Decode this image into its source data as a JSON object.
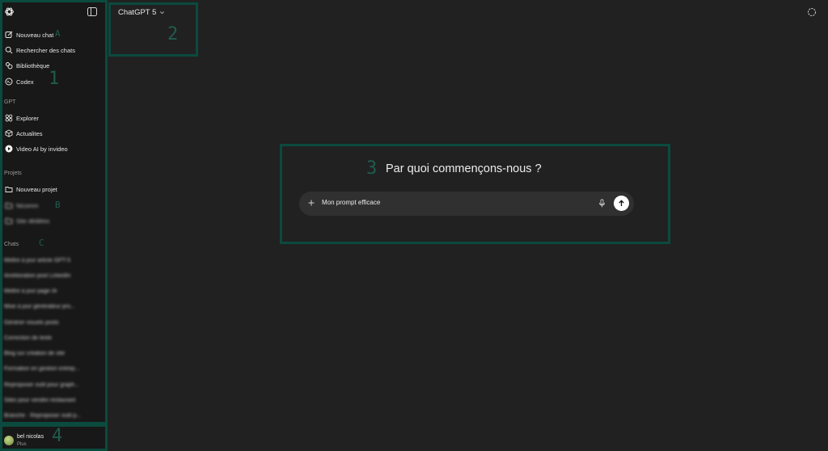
{
  "header": {
    "model_label": "ChatGPT 5"
  },
  "sidebar": {
    "main_items": [
      {
        "label": "Nouveau chat",
        "icon": "edit-icon"
      },
      {
        "label": "Rechercher des chats",
        "icon": "search-icon"
      },
      {
        "label": "Bibliothèque",
        "icon": "library-icon"
      },
      {
        "label": "Codex",
        "icon": "codex-icon"
      }
    ],
    "gpt_section": "GPT",
    "gpt_items": [
      {
        "label": "Explorer",
        "icon": "grid-icon"
      },
      {
        "label": "Actualites",
        "icon": "cube-icon"
      },
      {
        "label": "Video AI by invideo",
        "icon": "invideo-icon"
      }
    ],
    "projects_section": "Projets",
    "project_items": [
      {
        "label": "Nouveau projet",
        "icon": "folder-plus-icon"
      },
      {
        "label": "Nicomm",
        "icon": "folder-icon"
      },
      {
        "label": "Site dédiées",
        "icon": "folder-icon"
      }
    ],
    "chats_section": "Chats",
    "chats": [
      "Mettre à jour article GPT-5",
      "Amélioration post LinkedIn",
      "Mettre à jour page IA",
      "Mise à jour générateur pro...",
      "Générer visuels posts",
      "Correction de texte",
      "Blog sur création de site",
      "Formation en gestion entrep...",
      "Reproposer outil pour graph...",
      "Sites pour vendre restaurant",
      "Branche · Reproposer outil p..."
    ],
    "user": {
      "name": "bel nicolas",
      "plan": "Plus"
    }
  },
  "main": {
    "heading": "Par quoi commençons-nous ?",
    "composer_value": "Mon prompt efficace"
  },
  "annotations": {
    "a": "A",
    "b": "B",
    "c": "C",
    "n1": "1",
    "n2": "2",
    "n3": "3",
    "n4": "4"
  },
  "colors": {
    "annotation": "#0b4a3e",
    "background": "#212121",
    "sidebar": "#181818"
  }
}
